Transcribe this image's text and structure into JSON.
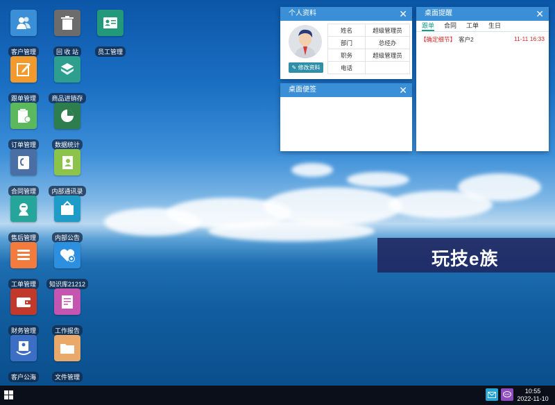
{
  "desktop_icons": [
    {
      "label": "客户管理",
      "icon": "customers-icon",
      "color": "#3a8fd6"
    },
    {
      "label": "回 收 站",
      "icon": "trash-icon",
      "color": "#6c6c6c"
    },
    {
      "label": "员工管理",
      "icon": "employee-card-icon",
      "color": "#21997a"
    },
    {
      "label": "跟单管理",
      "icon": "edit-icon",
      "color": "#f29a2e"
    },
    {
      "label": "商品进销存",
      "icon": "package-icon",
      "color": "#2e9e8f"
    },
    {
      "label": "订单管理",
      "icon": "clipboard-icon",
      "color": "#5cb85c"
    },
    {
      "label": "数据统计",
      "icon": "pie-chart-icon",
      "color": "#2e7d4f"
    },
    {
      "label": "合同管理",
      "icon": "contract-icon",
      "color": "#4a6fa5"
    },
    {
      "label": "内部通讯录",
      "icon": "address-book-icon",
      "color": "#8cc34a"
    },
    {
      "label": "售后管理",
      "icon": "support-agent-icon",
      "color": "#26a69a"
    },
    {
      "label": "内部公告",
      "icon": "notice-board-icon",
      "color": "#1e9bc7"
    },
    {
      "label": "工单管理",
      "icon": "list-icon",
      "color": "#f47b3e"
    },
    {
      "label": "知识库21212",
      "icon": "heart-plus-icon",
      "color": "#2d8fe0"
    },
    {
      "label": "财务管理",
      "icon": "wallet-icon",
      "color": "#c0392b"
    },
    {
      "label": "工作报告",
      "icon": "report-icon",
      "color": "#c455b0"
    },
    {
      "label": "客户公海",
      "icon": "client-pool-icon",
      "color": "#3c6fc4"
    },
    {
      "label": "文件管理",
      "icon": "folder-icon",
      "color": "#e8a96a"
    }
  ],
  "profile_panel": {
    "title": "个人资料",
    "edit_button": "修改资料",
    "rows": [
      {
        "key": "姓名",
        "value": "超级管理员"
      },
      {
        "key": "部门",
        "value": "总经办"
      },
      {
        "key": "职务",
        "value": "超级管理员"
      },
      {
        "key": "电话",
        "value": ""
      }
    ]
  },
  "notes_panel": {
    "title": "桌面便签",
    "content": ""
  },
  "reminder_panel": {
    "title": "桌面提醒",
    "tabs": [
      "跟单",
      "合同",
      "工单",
      "生日"
    ],
    "active_tab": 0,
    "items": [
      {
        "tag": "【确定细节】",
        "client": "客户2",
        "date": "11-11 16:33"
      }
    ]
  },
  "banner": {
    "text": "玩技e族"
  },
  "taskbar": {
    "time": "10:55",
    "date": "2022-11-10"
  },
  "close_glyph": "✕"
}
